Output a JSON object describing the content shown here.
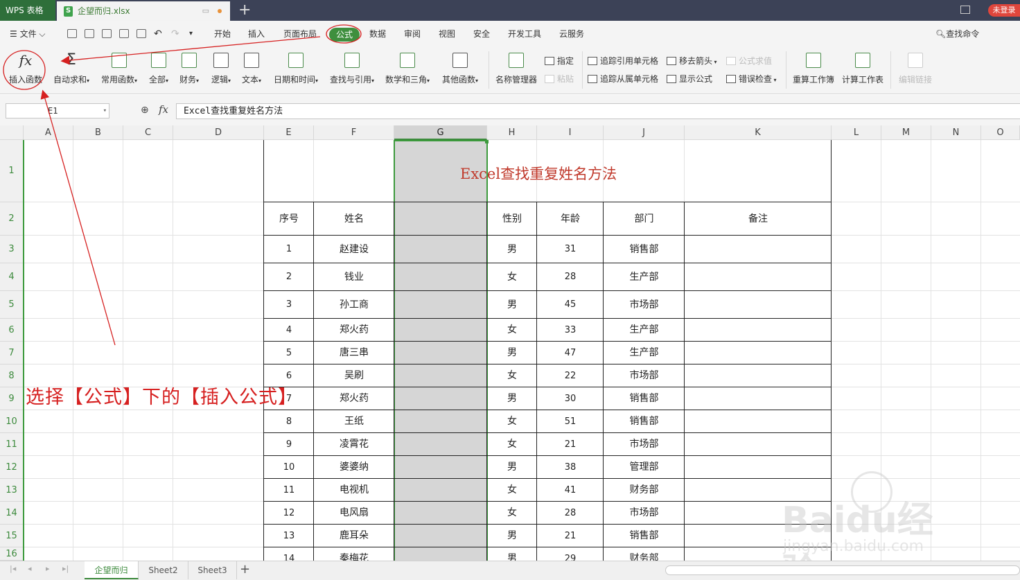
{
  "title_bar": {
    "app_name": "WPS 表格",
    "doc_tab": "企望而归.xlsx",
    "new_tab": "+",
    "login": "未登录"
  },
  "menu": {
    "file": "文件",
    "tabs": [
      "开始",
      "插入",
      "页面布局",
      "公式",
      "数据",
      "审阅",
      "视图",
      "安全",
      "开发工具",
      "云服务"
    ],
    "active_tab": "公式",
    "search_cmd": "查找命令"
  },
  "ribbon": {
    "insert_function": "插入函数",
    "autosum": "自动求和",
    "common": "常用函数",
    "all": "全部",
    "finance": "财务",
    "logic": "逻辑",
    "text": "文本",
    "datetime": "日期和时间",
    "lookup": "查找与引用",
    "math": "数学和三角",
    "other": "其他函数",
    "name_manager": "名称管理器",
    "specify": "指定",
    "paste": "粘贴",
    "trace_precedents": "追踪引用单元格",
    "trace_dependents": "追踪从属单元格",
    "remove_arrows": "移去箭头",
    "show_formulas": "显示公式",
    "evaluate": "公式求值",
    "error_check": "错误检查",
    "recalc_workbook": "重算工作簿",
    "calc_sheet": "计算工作表",
    "edit_links": "编辑链接"
  },
  "formula_bar": {
    "name_box": "E1",
    "fx": "fx",
    "content": "Excel查找重复姓名方法"
  },
  "grid": {
    "columns": [
      "A",
      "B",
      "C",
      "D",
      "E",
      "F",
      "G",
      "H",
      "I",
      "J",
      "K",
      "L",
      "M",
      "N",
      "O"
    ],
    "selected_column": "G",
    "rows": [
      "1",
      "2",
      "3",
      "4",
      "5",
      "6",
      "7",
      "8",
      "9",
      "10",
      "11",
      "12",
      "13",
      "14",
      "15",
      "16"
    ]
  },
  "sheet": {
    "title": "Excel查找重复姓名方法",
    "headers": [
      "序号",
      "姓名",
      "性别",
      "年龄",
      "部门",
      "备注"
    ],
    "rows": [
      [
        "1",
        "赵建设",
        "男",
        "31",
        "销售部"
      ],
      [
        "2",
        "钱业",
        "女",
        "28",
        "生产部"
      ],
      [
        "3",
        "孙工商",
        "男",
        "45",
        "市场部"
      ],
      [
        "4",
        "郑火药",
        "女",
        "33",
        "生产部"
      ],
      [
        "5",
        "唐三串",
        "男",
        "47",
        "生产部"
      ],
      [
        "6",
        "吴刷",
        "女",
        "22",
        "市场部"
      ],
      [
        "7",
        "郑火药",
        "男",
        "30",
        "销售部"
      ],
      [
        "8",
        "王纸",
        "女",
        "51",
        "销售部"
      ],
      [
        "9",
        "凌霄花",
        "女",
        "21",
        "市场部"
      ],
      [
        "10",
        "婆婆纳",
        "男",
        "38",
        "管理部"
      ],
      [
        "11",
        "电视机",
        "女",
        "41",
        "财务部"
      ],
      [
        "12",
        "电风扇",
        "女",
        "28",
        "市场部"
      ],
      [
        "13",
        "鹿耳朵",
        "男",
        "21",
        "销售部"
      ],
      [
        "14",
        "秦梅花",
        "男",
        "29",
        "财务部"
      ]
    ]
  },
  "annotation": "选择【公式】下的【插入公式】",
  "watermark": {
    "brand": "Baidu经验",
    "url": "jingyan.baidu.com"
  },
  "sheet_tabs": [
    "企望而归",
    "Sheet2",
    "Sheet3"
  ],
  "add_sheet": "+",
  "colors": {
    "accent_green": "#3e8f3e",
    "annotation_red": "#d62020",
    "title_red": "#c0392b",
    "titlebar": "#3c4257"
  }
}
